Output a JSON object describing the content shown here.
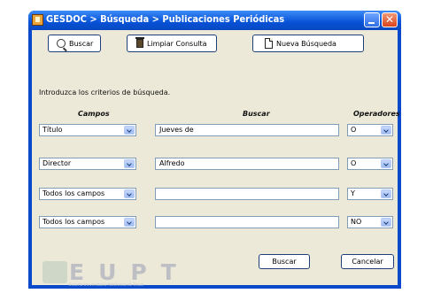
{
  "window": {
    "title": "GESDOC > Búsqueda > Publicaciones Periódicas",
    "close_glyph": "✕"
  },
  "toolbar": {
    "search_label": "Buscar",
    "clear_label": "Limpiar Consulta",
    "new_label": "Nueva Búsqueda"
  },
  "instructions": "Introduzca los criterios de búsqueda.",
  "columns": {
    "fields": "Campos",
    "search": "Buscar",
    "operators": "Operadores"
  },
  "rows": [
    {
      "field": "Título",
      "value": "Jueves de",
      "operator": "O"
    },
    {
      "field": "Director",
      "value": "Alfredo",
      "operator": "O"
    },
    {
      "field": "Todos los campos",
      "value": "",
      "operator": "Y"
    },
    {
      "field": "Todos los campos",
      "value": "",
      "operator": "NO"
    }
  ],
  "footer": {
    "search_label": "Buscar",
    "cancel_label": "Cancelar"
  },
  "logo": {
    "text": "EUPT",
    "subtitle": "Escuela Universitaria Politécnica de Teruel"
  },
  "colors": {
    "titlebar": "#0752d6",
    "client_bg": "#ece9d8",
    "close": "#d8431b"
  }
}
